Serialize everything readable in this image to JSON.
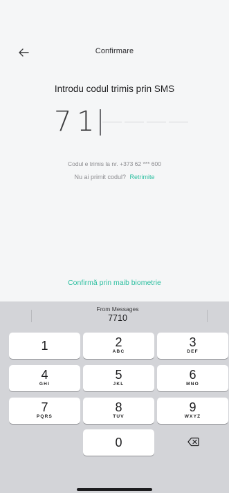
{
  "header": {
    "title": "Confirmare"
  },
  "heading": "Introdu codul trimis prin SMS",
  "code": {
    "digits": [
      "7",
      "1"
    ],
    "slots_total": 6
  },
  "info": {
    "sent_to_label": "Codul e trimis la nr.",
    "phone": "+373 62 *** 600",
    "not_received": "Nu ai primit codul?",
    "resend": "Retrimite"
  },
  "biometric_label": "Confirmă prin maib biometrie",
  "keyboard": {
    "suggestion": {
      "source": "From Messages",
      "code": "7710"
    },
    "keys": [
      {
        "num": "1",
        "letters": ""
      },
      {
        "num": "2",
        "letters": "ABC"
      },
      {
        "num": "3",
        "letters": "DEF"
      },
      {
        "num": "4",
        "letters": "GHI"
      },
      {
        "num": "5",
        "letters": "JKL"
      },
      {
        "num": "6",
        "letters": "MNO"
      },
      {
        "num": "7",
        "letters": "PQRS"
      },
      {
        "num": "8",
        "letters": "TUV"
      },
      {
        "num": "9",
        "letters": "WXYZ"
      },
      {
        "num": "0",
        "letters": ""
      }
    ]
  },
  "colors": {
    "accent": "#2cbfa0",
    "background": "#f5f6f7",
    "keyboard": "#d3d4d8"
  },
  "icons": {
    "back": "arrow-left-icon",
    "delete": "backspace-icon"
  }
}
